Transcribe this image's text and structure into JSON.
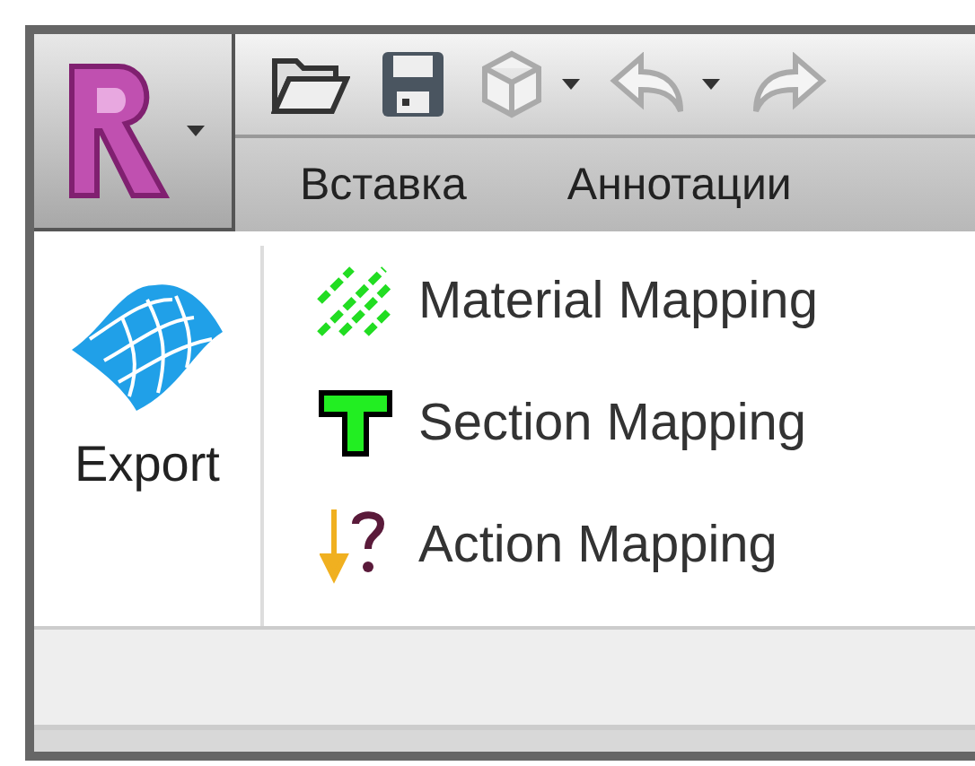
{
  "tabs": [
    {
      "label": "Вставка"
    },
    {
      "label": "Аннотации"
    }
  ],
  "ribbon": {
    "large_button": {
      "label": "Export"
    },
    "small_buttons": [
      {
        "label": "Material Mapping"
      },
      {
        "label": "Section Mapping"
      },
      {
        "label": "Action Mapping"
      }
    ]
  }
}
